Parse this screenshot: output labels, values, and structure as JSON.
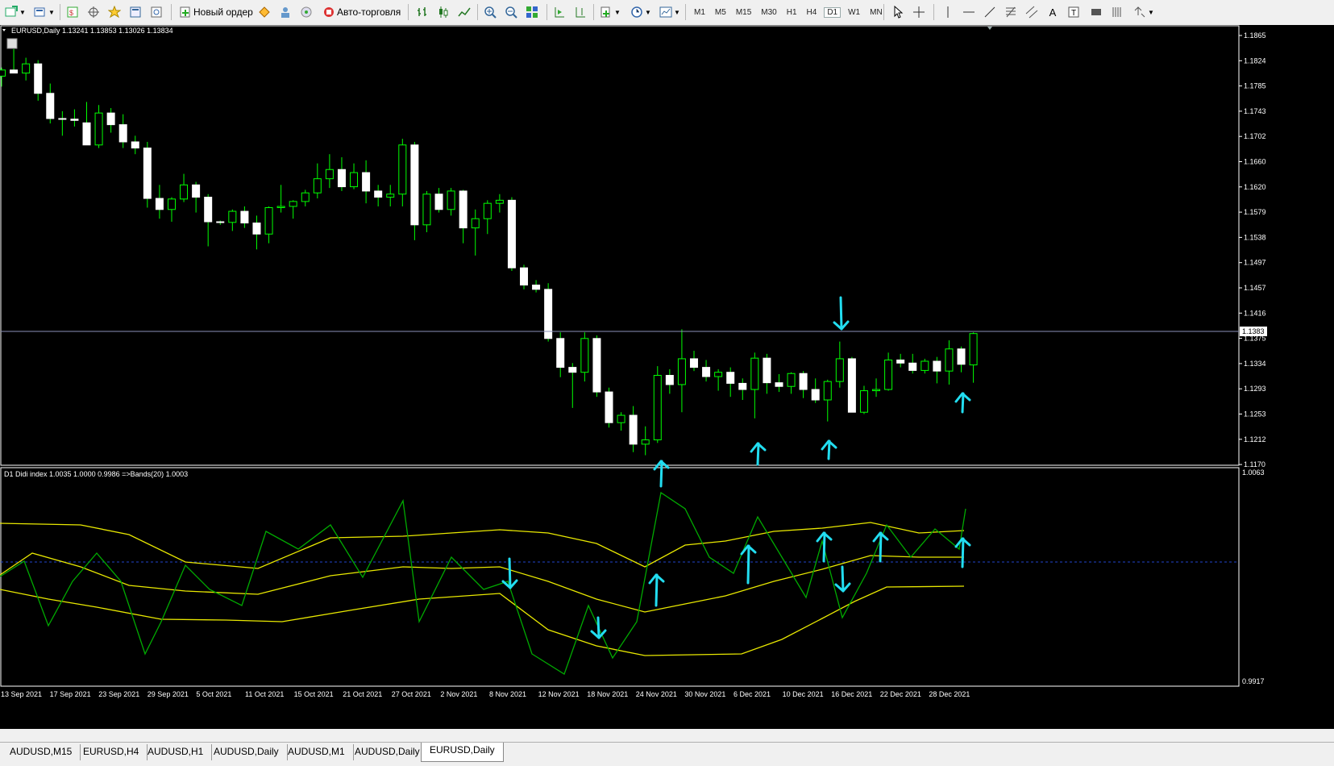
{
  "toolbar": {
    "new_order_label": "Новый ордер",
    "autotrading_label": "Авто-торговля",
    "timeframes": [
      "M1",
      "M5",
      "M15",
      "M30",
      "H1",
      "H4",
      "D1",
      "W1",
      "MN"
    ],
    "active_timeframe": "D1",
    "drawing_tools": [
      "cursor-icon",
      "crosshair-icon",
      "vertical-line-icon",
      "horizontal-line-icon",
      "trendline-icon",
      "fibonacci-icon",
      "text-icon",
      "label-icon",
      "rectangle-icon",
      "channel-icon",
      "arrows-icon"
    ]
  },
  "main_chart": {
    "header": "EURUSD,Daily  1.13241 1.13853 1.13026 1.13834",
    "price_labels": [
      "1.1865",
      "1.1824",
      "1.1785",
      "1.1743",
      "1.1702",
      "1.1660",
      "1.1620",
      "1.1579",
      "1.1538",
      "1.1497",
      "1.1457",
      "1.1416",
      "1.1375",
      "1.1334",
      "1.1293",
      "1.1253",
      "1.1212",
      "1.1170"
    ],
    "current_price": "1.1383"
  },
  "indicator": {
    "header": "D1 Didi index 1.0035 1.0000 0.9986  =>Bands(20) 1.0003",
    "top_label": "1.0063",
    "bottom_label": "0.9917"
  },
  "date_labels": [
    "13 Sep 2021",
    "17 Sep 2021",
    "23 Sep 2021",
    "29 Sep 2021",
    "5 Oct 2021",
    "11 Oct 2021",
    "15 Oct 2021",
    "21 Oct 2021",
    "27 Oct 2021",
    "2 Nov 2021",
    "8 Nov 2021",
    "12 Nov 2021",
    "18 Nov 2021",
    "24 Nov 2021",
    "30 Nov 2021",
    "6 Dec 2021",
    "10 Dec 2021",
    "16 Dec 2021",
    "22 Dec 2021",
    "28 Dec 2021"
  ],
  "tabs": [
    "AUDUSD,M15",
    "EURUSD,H4",
    "AUDUSD,H1",
    "AUDUSD,Daily",
    "AUDUSD,M1",
    "AUDUSD,Daily",
    "EURUSD,Daily"
  ],
  "active_tab": "EURUSD,Daily",
  "colors": {
    "background": "#000000",
    "candle_up": "#000000",
    "candle_body": "#ffffff",
    "wick": "#00ff00",
    "band": "#e8e800",
    "didi": "#00aa00",
    "annotation": "#22ddf0",
    "price_line": "#8a8fb8"
  },
  "chart_data": {
    "type": "candlestick",
    "symbol": "EURUSD",
    "timeframe": "Daily",
    "ylim": [
      1.117,
      1.188
    ],
    "ohlc": [
      [
        1.1802,
        1.1816,
        1.1785,
        1.1812
      ],
      [
        1.1812,
        1.1846,
        1.1808,
        1.1807
      ],
      [
        1.1807,
        1.1832,
        1.1795,
        1.1822
      ],
      [
        1.1822,
        1.1828,
        1.1762,
        1.1774
      ],
      [
        1.1774,
        1.179,
        1.1725,
        1.1733
      ],
      [
        1.1733,
        1.1745,
        1.1705,
        1.1732
      ],
      [
        1.1732,
        1.1748,
        1.172,
        1.173
      ],
      [
        1.1726,
        1.176,
        1.172,
        1.169
      ],
      [
        1.169,
        1.1755,
        1.1685,
        1.1742
      ],
      [
        1.1742,
        1.175,
        1.171,
        1.1723
      ],
      [
        1.1723,
        1.174,
        1.1685,
        1.1695
      ],
      [
        1.1695,
        1.1705,
        1.1675,
        1.1685
      ],
      [
        1.1685,
        1.1695,
        1.1588,
        1.1603
      ],
      [
        1.1603,
        1.1625,
        1.157,
        1.1585
      ],
      [
        1.1585,
        1.1605,
        1.1565,
        1.1602
      ],
      [
        1.1602,
        1.1643,
        1.1597,
        1.1625
      ],
      [
        1.1625,
        1.163,
        1.158,
        1.1605
      ],
      [
        1.1605,
        1.161,
        1.1525,
        1.1565
      ],
      [
        1.1565,
        1.1567,
        1.156,
        1.1564
      ],
      [
        1.1564,
        1.1585,
        1.155,
        1.1582
      ],
      [
        1.1582,
        1.159,
        1.1555,
        1.1563
      ],
      [
        1.1563,
        1.1575,
        1.152,
        1.1545
      ],
      [
        1.1545,
        1.159,
        1.153,
        1.1588
      ],
      [
        1.1588,
        1.1625,
        1.158,
        1.159
      ],
      [
        1.159,
        1.16,
        1.157,
        1.1598
      ],
      [
        1.1598,
        1.1617,
        1.159,
        1.1612
      ],
      [
        1.1612,
        1.166,
        1.1603,
        1.1635
      ],
      [
        1.1635,
        1.1675,
        1.162,
        1.165
      ],
      [
        1.165,
        1.167,
        1.1615,
        1.1622
      ],
      [
        1.1622,
        1.166,
        1.1618,
        1.1645
      ],
      [
        1.1645,
        1.1665,
        1.1595,
        1.1615
      ],
      [
        1.1615,
        1.1625,
        1.159,
        1.1605
      ],
      [
        1.1605,
        1.1625,
        1.159,
        1.161
      ],
      [
        1.161,
        1.17,
        1.159,
        1.169
      ],
      [
        1.169,
        1.1695,
        1.1535,
        1.156
      ],
      [
        1.156,
        1.1615,
        1.1548,
        1.161
      ],
      [
        1.161,
        1.162,
        1.158,
        1.1585
      ],
      [
        1.1585,
        1.162,
        1.1575,
        1.1615
      ],
      [
        1.1615,
        1.1617,
        1.153,
        1.1555
      ],
      [
        1.1555,
        1.1585,
        1.151,
        1.157
      ],
      [
        1.157,
        1.16,
        1.1545,
        1.1595
      ],
      [
        1.1595,
        1.161,
        1.158,
        1.16
      ],
      [
        1.16,
        1.1605,
        1.1485,
        1.149
      ],
      [
        1.149,
        1.1495,
        1.1455,
        1.1462
      ],
      [
        1.1462,
        1.147,
        1.145,
        1.1455
      ],
      [
        1.1455,
        1.1465,
        1.137,
        1.1375
      ],
      [
        1.1375,
        1.1385,
        1.1312,
        1.1328
      ],
      [
        1.1328,
        1.1335,
        1.1262,
        1.132
      ],
      [
        1.132,
        1.1385,
        1.1305,
        1.1375
      ],
      [
        1.1375,
        1.138,
        1.128,
        1.1288
      ],
      [
        1.1288,
        1.1295,
        1.123,
        1.1238
      ],
      [
        1.1238,
        1.1255,
        1.1225,
        1.125
      ],
      [
        1.125,
        1.1265,
        1.119,
        1.1203
      ],
      [
        1.1203,
        1.1232,
        1.1185,
        1.121
      ],
      [
        1.121,
        1.133,
        1.1205,
        1.1315
      ],
      [
        1.1315,
        1.1325,
        1.1285,
        1.13
      ],
      [
        1.13,
        1.139,
        1.1255,
        1.1342
      ],
      [
        1.1342,
        1.1355,
        1.1322,
        1.1328
      ],
      [
        1.1328,
        1.134,
        1.1305,
        1.1313
      ],
      [
        1.1313,
        1.1325,
        1.129,
        1.132
      ],
      [
        1.132,
        1.1328,
        1.128,
        1.1302
      ],
      [
        1.1302,
        1.131,
        1.1275,
        1.1292
      ],
      [
        1.1292,
        1.1352,
        1.1245,
        1.1343
      ],
      [
        1.1343,
        1.135,
        1.1285,
        1.1303
      ],
      [
        1.1303,
        1.1317,
        1.1288,
        1.1297
      ],
      [
        1.1297,
        1.132,
        1.1285,
        1.1318
      ],
      [
        1.1318,
        1.1322,
        1.1278,
        1.1292
      ],
      [
        1.1292,
        1.131,
        1.127,
        1.1275
      ],
      [
        1.1275,
        1.1308,
        1.124,
        1.1305
      ],
      [
        1.1305,
        1.137,
        1.1295,
        1.1342
      ],
      [
        1.1342,
        1.1345,
        1.1255,
        1.1255
      ],
      [
        1.1255,
        1.1298,
        1.1252,
        1.129
      ],
      [
        1.129,
        1.131,
        1.128,
        1.1292
      ],
      [
        1.1292,
        1.1352,
        1.129,
        1.134
      ],
      [
        1.134,
        1.135,
        1.1328,
        1.1335
      ],
      [
        1.1335,
        1.135,
        1.1318,
        1.1323
      ],
      [
        1.1323,
        1.1342,
        1.1318,
        1.1338
      ],
      [
        1.1338,
        1.1345,
        1.1302,
        1.1322
      ],
      [
        1.1322,
        1.1372,
        1.13,
        1.1358
      ],
      [
        1.1358,
        1.1362,
        1.132,
        1.1333
      ],
      [
        1.1332,
        1.1385,
        1.1303,
        1.1383
      ]
    ]
  }
}
